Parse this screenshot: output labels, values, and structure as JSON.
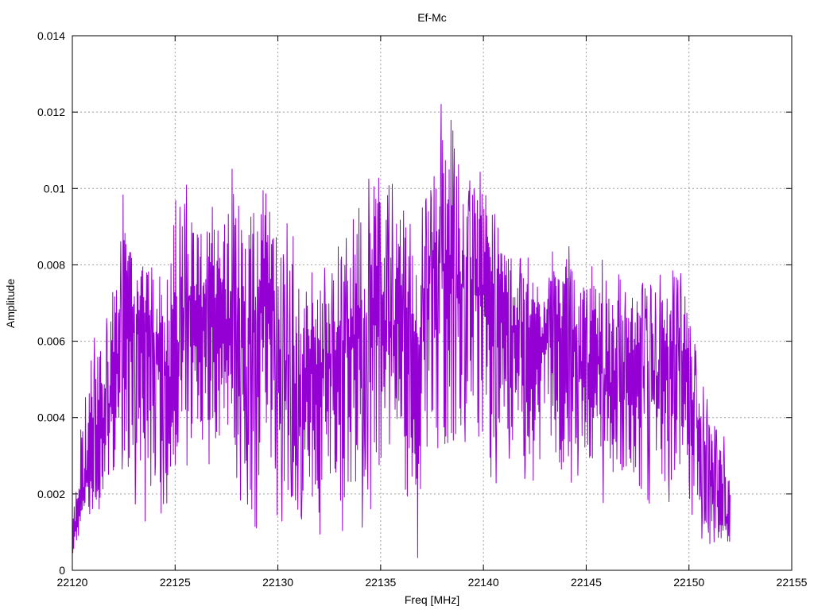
{
  "chart_data": {
    "type": "line",
    "title": "Ef-Mc",
    "xlabel": "Freq [MHz]",
    "ylabel": "Amplitude",
    "xlim": [
      22120,
      22155
    ],
    "ylim": [
      0,
      0.014
    ],
    "xticks": [
      22120,
      22125,
      22130,
      22135,
      22140,
      22145,
      22150,
      22155
    ],
    "xtick_labels": [
      "22120",
      "22125",
      "22130",
      "22135",
      "22140",
      "22145",
      "22150",
      "22155"
    ],
    "yticks": [
      0,
      0.002,
      0.004,
      0.006,
      0.008,
      0.01,
      0.012,
      0.014
    ],
    "ytick_labels": [
      "0",
      "0.002",
      "0.004",
      "0.006",
      "0.008",
      "0.01",
      "0.012",
      "0.014"
    ],
    "grid": true,
    "legend": "none",
    "series": [
      {
        "color": "#9400d3",
        "x": [
          22120.0,
          22120.8,
          22121.6,
          22122.4,
          22123.2,
          22124.0,
          22124.8,
          22125.6,
          22126.4,
          22127.2,
          22128.0,
          22128.8,
          22129.6,
          22130.4,
          22131.2,
          22132.0,
          22132.8,
          22133.6,
          22134.4,
          22135.2,
          22136.0,
          22136.8,
          22137.6,
          22138.4,
          22139.2,
          22140.0,
          22140.8,
          22141.6,
          22142.4,
          22143.2,
          22144.0,
          22144.8,
          22145.6,
          22146.4,
          22147.2,
          22148.0,
          22148.8,
          22149.6,
          22150.4,
          22151.2,
          22152.0
        ],
        "y": [
          0.0008,
          0.0025,
          0.0038,
          0.0062,
          0.0067,
          0.0058,
          0.0049,
          0.0072,
          0.0068,
          0.006,
          0.0066,
          0.0063,
          0.0075,
          0.0044,
          0.0051,
          0.0052,
          0.0056,
          0.0058,
          0.0068,
          0.0062,
          0.0066,
          0.0053,
          0.0083,
          0.0078,
          0.0073,
          0.0074,
          0.0067,
          0.0062,
          0.0058,
          0.0061,
          0.0064,
          0.0052,
          0.0055,
          0.0043,
          0.005,
          0.0047,
          0.0052,
          0.0056,
          0.0038,
          0.0021,
          0.0011
        ],
        "peak_envelope": [
          0.0015,
          0.0065,
          0.0072,
          0.01,
          0.0085,
          0.0082,
          0.0097,
          0.0103,
          0.0096,
          0.0097,
          0.0113,
          0.0109,
          0.0101,
          0.0094,
          0.0082,
          0.0081,
          0.0084,
          0.0103,
          0.0118,
          0.0103,
          0.0104,
          0.0087,
          0.0115,
          0.0134,
          0.0101,
          0.0113,
          0.0097,
          0.0084,
          0.0082,
          0.0083,
          0.0088,
          0.0081,
          0.0084,
          0.0077,
          0.0079,
          0.0077,
          0.008,
          0.0088,
          0.0055,
          0.0038,
          0.0035
        ],
        "trough_envelope": [
          0.0003,
          0.0012,
          0.0015,
          0.0021,
          0.0009,
          0.0011,
          0.0016,
          0.0021,
          0.0023,
          0.0024,
          0.0016,
          0.0009,
          0.0013,
          0.0012,
          0.0004,
          0.0007,
          0.0011,
          0.0007,
          0.0012,
          0.0017,
          0.0021,
          0.0003,
          0.0013,
          0.0019,
          0.0026,
          0.0016,
          0.0023,
          0.0021,
          0.0022,
          0.0019,
          0.0022,
          0.0025,
          0.0017,
          0.0019,
          0.002,
          0.0004,
          0.0012,
          0.0014,
          0.0006,
          0.0005,
          0.0006
        ]
      }
    ]
  }
}
